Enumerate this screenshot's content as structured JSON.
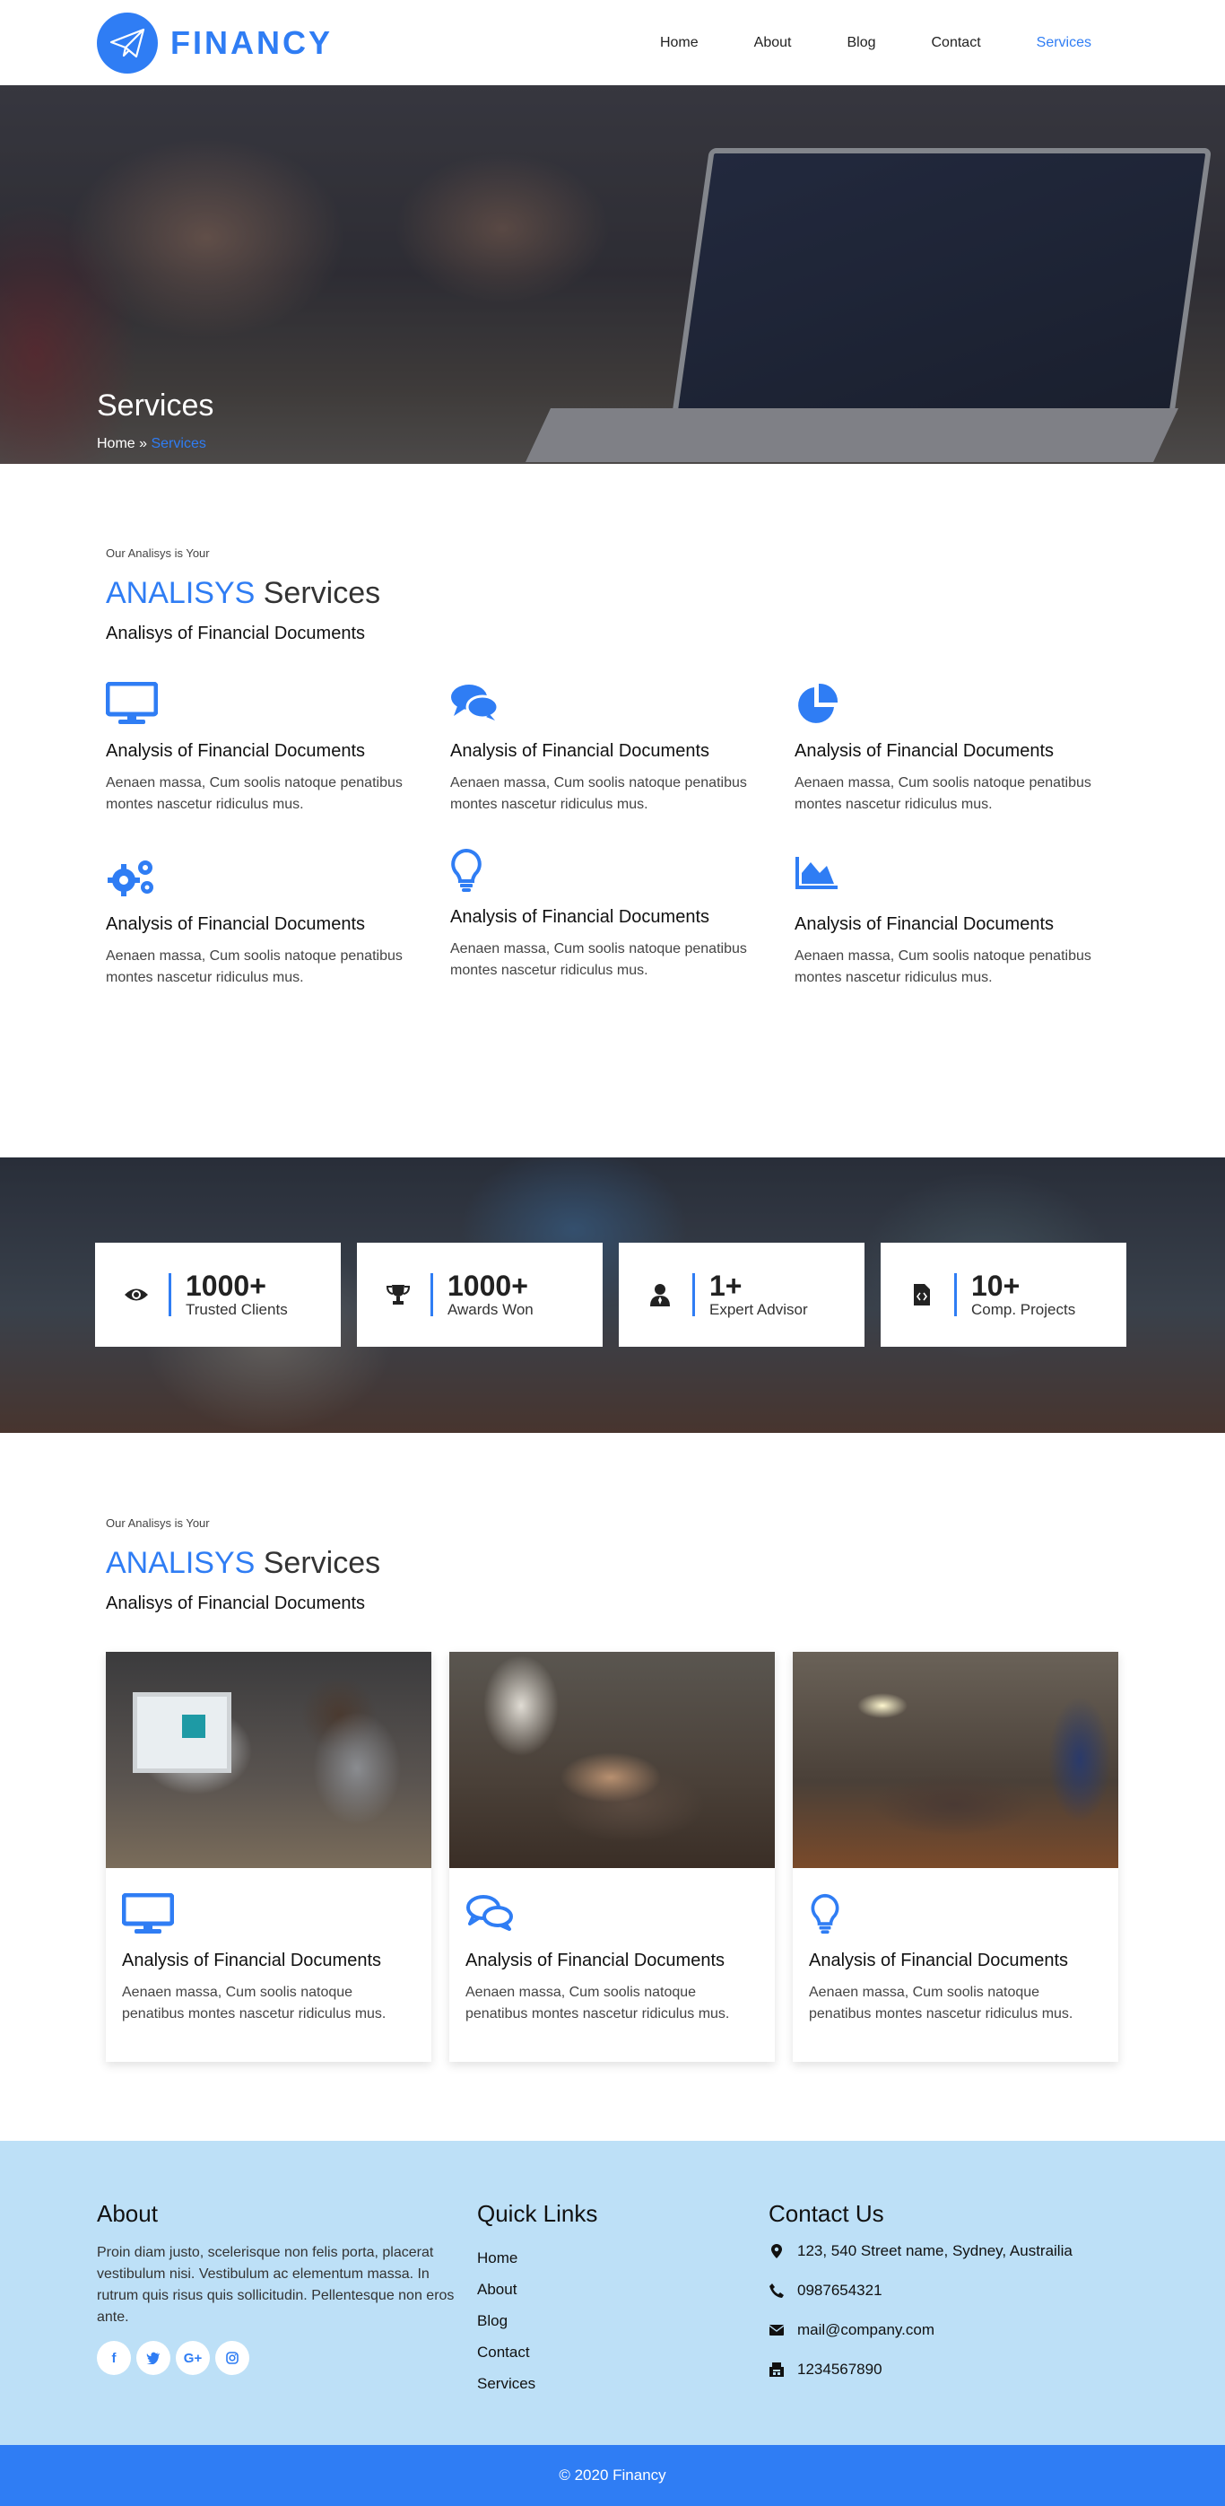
{
  "brand": {
    "name": "FINANCY",
    "accent_color": "#2f7df4"
  },
  "nav": {
    "items": [
      {
        "label": "Home"
      },
      {
        "label": "About"
      },
      {
        "label": "Blog"
      },
      {
        "label": "Contact"
      },
      {
        "label": "Services",
        "active": true
      }
    ]
  },
  "hero": {
    "title": "Services",
    "breadcrumb_home": "Home",
    "breadcrumb_sep": " » ",
    "breadcrumb_current": "Services"
  },
  "section1": {
    "eyebrow": "Our Analisys is Your",
    "title_accent": "ANALISYS",
    "title_rest": " Services",
    "subtitle": "Analisys of Financial Documents",
    "items": [
      {
        "icon": "desktop-icon",
        "title": "Analysis of Financial Documents",
        "text": "Aenaen massa, Cum soolis natoque penatibus montes nascetur ridiculus mus."
      },
      {
        "icon": "comments-icon",
        "title": "Analysis of Financial Documents",
        "text": "Aenaen massa, Cum soolis natoque penatibus montes nascetur ridiculus mus."
      },
      {
        "icon": "pie-chart-icon",
        "title": "Analysis of Financial Documents",
        "text": "Aenaen massa, Cum soolis natoque penatibus montes nascetur ridiculus mus."
      },
      {
        "icon": "gears-icon",
        "title": "Analysis of Financial Documents",
        "text": "Aenaen massa, Cum soolis natoque penatibus montes nascetur ridiculus mus."
      },
      {
        "icon": "lightbulb-icon",
        "title": "Analysis of Financial Documents",
        "text": "Aenaen massa, Cum soolis natoque penatibus montes nascetur ridiculus mus."
      },
      {
        "icon": "area-chart-icon",
        "title": "Analysis of Financial Documents",
        "text": "Aenaen massa, Cum soolis natoque penatibus montes nascetur ridiculus mus."
      }
    ]
  },
  "counters": [
    {
      "icon": "eye-icon",
      "value": "1000+",
      "label": "Trusted Clients"
    },
    {
      "icon": "trophy-icon",
      "value": "1000+",
      "label": "Awards Won"
    },
    {
      "icon": "user-tie-icon",
      "value": "1+",
      "label": "Expert Advisor"
    },
    {
      "icon": "file-code-icon",
      "value": "10+",
      "label": "Comp. Projects"
    }
  ],
  "section2": {
    "eyebrow": "Our Analisys is Your",
    "title_accent": "ANALISYS",
    "title_rest": " Services",
    "subtitle": "Analisys of Financial Documents",
    "cards": [
      {
        "icon": "desktop-icon",
        "title": "Analysis of Financial Documents",
        "text": "Aenaen massa, Cum soolis natoque penatibus montes nascetur ridiculus mus."
      },
      {
        "icon": "comments-outline-icon",
        "title": "Analysis of Financial Documents",
        "text": "Aenaen massa, Cum soolis natoque penatibus montes nascetur ridiculus mus."
      },
      {
        "icon": "lightbulb-icon",
        "title": "Analysis of Financial Documents",
        "text": "Aenaen massa, Cum soolis natoque penatibus montes nascetur ridiculus mus."
      }
    ]
  },
  "footer": {
    "about_title": "About",
    "about_text": "Proin diam justo, scelerisque non felis porta, placerat vestibulum nisi. Vestibulum ac elementum massa. In rutrum quis risus quis sollicitudin. Pellentesque non eros ante.",
    "socials": [
      {
        "icon": "facebook-icon",
        "glyph": "f"
      },
      {
        "icon": "twitter-icon",
        "glyph": "t"
      },
      {
        "icon": "google-plus-icon",
        "glyph": "G+"
      },
      {
        "icon": "instagram-icon",
        "glyph": "◎"
      }
    ],
    "links_title": "Quick Links",
    "links": [
      "Home",
      "About",
      "Blog",
      "Contact",
      "Services"
    ],
    "contact_title": "Contact Us",
    "address": "123, 540 Street name, Sydney, Austrailia",
    "phone": "0987654321",
    "email": "mail@company.com",
    "fax": "1234567890"
  },
  "copyright": "© 2020 Financy"
}
